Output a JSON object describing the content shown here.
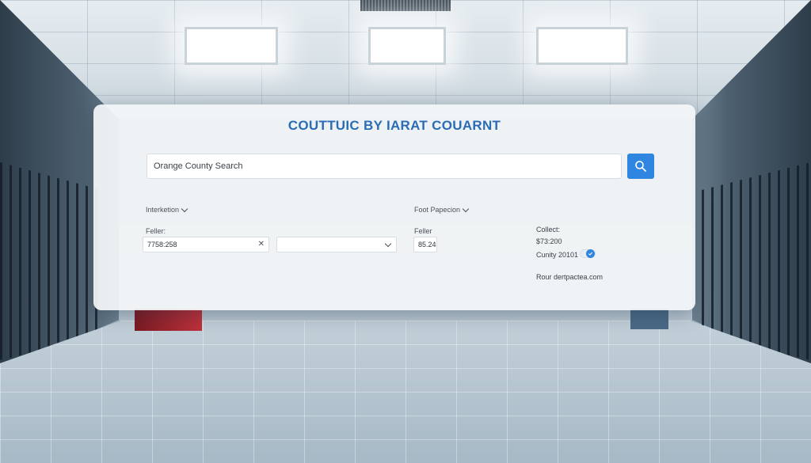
{
  "panel": {
    "title": "COUTTUIC BY IARAT COUARNT"
  },
  "search": {
    "value": "Orange County Search",
    "button_icon": "search-icon"
  },
  "filters": {
    "left_dropdown_label": "Interketion",
    "right_dropdown_label": "Foot Papecion"
  },
  "fields": {
    "left_label": "Feller:",
    "left_value": "7758:258",
    "left_clear_icon": "close-icon",
    "select_value": "",
    "select_icon": "chevron-down-icon",
    "middle_label": "Feller",
    "middle_value": "85.24"
  },
  "info": {
    "heading": "Collect:",
    "amount": "$73:200",
    "county": "Cunity 20101",
    "toggle_on": true,
    "footer": "Rour dertpactea.com"
  },
  "colors": {
    "accent": "#2f86e0",
    "title": "#2a6db5"
  }
}
